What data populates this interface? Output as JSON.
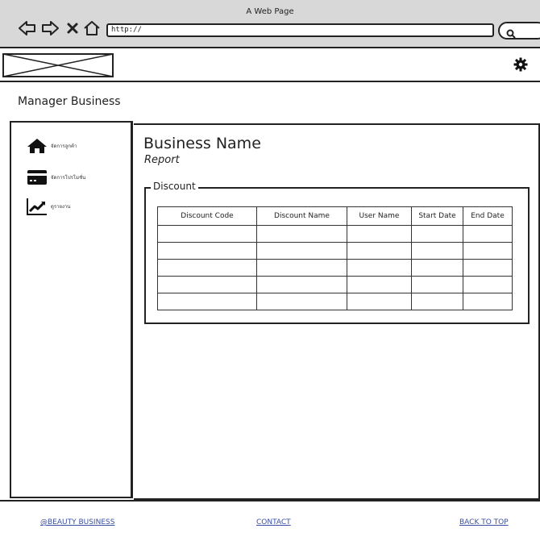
{
  "browser": {
    "window_title": "A Web Page",
    "url": "http://",
    "icons": [
      "back-arrow-icon",
      "forward-arrow-icon",
      "close-icon",
      "home-icon",
      "search-icon"
    ]
  },
  "header": {
    "logo": "logo-placeholder",
    "settings_icon": "gear-icon"
  },
  "app": {
    "title": "Manager Business"
  },
  "sidebar": {
    "items": [
      {
        "icon": "home-icon",
        "label": "จัดการลูกค้า"
      },
      {
        "icon": "credit-card-icon",
        "label": "จัดการโปรโมชั่น"
      },
      {
        "icon": "trend-chart-icon",
        "label": "ดูรายงาน"
      }
    ]
  },
  "main": {
    "business_name": "Business Name",
    "subtitle": "Report",
    "discount_section": {
      "legend": "Discount",
      "columns": [
        "Discount Code",
        "Discount Name",
        "User Name",
        "Start Date",
        "End Date"
      ],
      "rows": [
        [
          "",
          "",
          "",
          "",
          ""
        ],
        [
          "",
          "",
          "",
          "",
          ""
        ],
        [
          "",
          "",
          "",
          "",
          ""
        ],
        [
          "",
          "",
          "",
          "",
          ""
        ],
        [
          "",
          "",
          "",
          "",
          ""
        ]
      ]
    }
  },
  "footer": {
    "brand_link": "@BEAUTY BUSINESS",
    "contact_link": "CONTACT",
    "back_to_top_link": "BACK TO TOP"
  }
}
